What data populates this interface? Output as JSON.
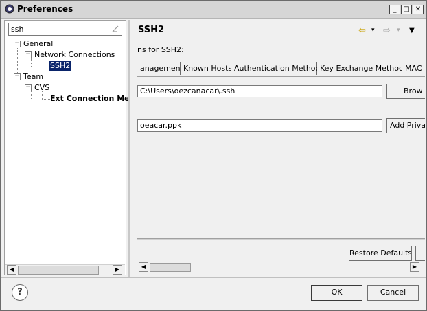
{
  "window": {
    "title": "Preferences",
    "minimize": "_",
    "maximize": "□",
    "close": "✕"
  },
  "filter": {
    "value": "ssh"
  },
  "tree": {
    "general": "General",
    "network_connections": "Network Connections",
    "ssh2": "SSH2",
    "team": "Team",
    "cvs": "CVS",
    "ext_connection": "Ext Connection Me"
  },
  "page": {
    "title": "SSH2",
    "description": "ns for SSH2:"
  },
  "tabs": [
    {
      "label": "anagement"
    },
    {
      "label": "Known Hosts"
    },
    {
      "label": "Authentication Methods"
    },
    {
      "label": "Key Exchange Methods"
    },
    {
      "label": "MAC"
    }
  ],
  "fields": {
    "ssh_home": "C:\\Users\\oezcanacar\\.ssh",
    "private_keys": "oeacar.ppk"
  },
  "buttons": {
    "browse": "Brow",
    "add_private_key": "Add Priva",
    "restore_defaults": "Restore Defaults",
    "ok": "OK",
    "cancel": "Cancel",
    "help": "?"
  },
  "icons": {
    "back": "⇦",
    "forward": "⇨",
    "dropdown": "▾",
    "menu": "▼"
  },
  "colors": {
    "selection_bg": "#0a246a",
    "selection_fg": "#ffffff"
  }
}
